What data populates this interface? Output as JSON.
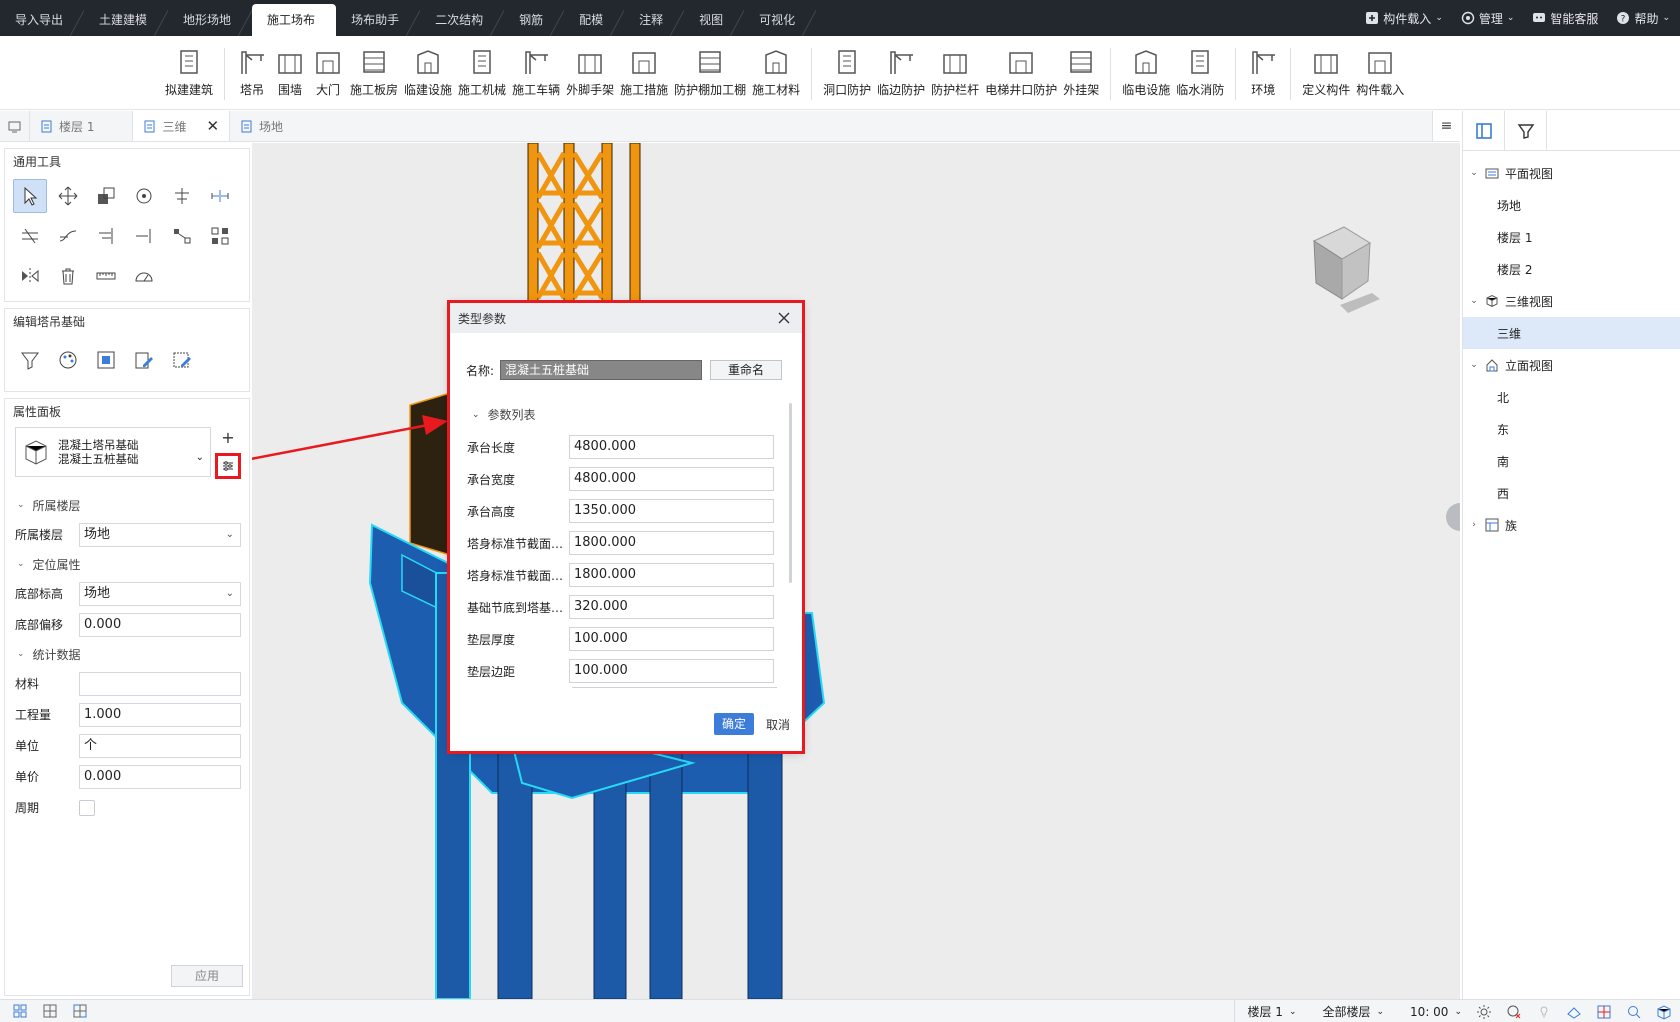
{
  "menu": {
    "tabs": [
      "导入导出",
      "土建建模",
      "地形场地",
      "施工场布",
      "场布助手",
      "二次结构",
      "钢筋",
      "配模",
      "注释",
      "视图",
      "可视化"
    ],
    "active_index": 3,
    "right": {
      "load": "构件载入",
      "manage": "管理",
      "service": "智能客服",
      "help": "帮助"
    }
  },
  "ribbon": {
    "groups": [
      [
        "拟建建筑"
      ],
      [
        "塔吊",
        "围墙",
        "大门",
        "施工板房",
        "临建设施",
        "施工机械",
        "施工车辆",
        "外脚手架",
        "施工措施",
        "防护棚加工棚",
        "施工材料"
      ],
      [
        "洞口防护",
        "临边防护",
        "防护栏杆",
        "电梯井口防护",
        "外挂架"
      ],
      [
        "临电设施",
        "临水消防"
      ],
      [
        "环境"
      ],
      [
        "定义构件",
        "构件载入"
      ]
    ]
  },
  "viewtabs": {
    "tabs": [
      "楼层 1",
      "三维",
      "场地"
    ],
    "active_index": 1
  },
  "leftpanel": {
    "tools_title": "通用工具",
    "edit_title": "编辑塔吊基础",
    "props_title": "属性面板",
    "type_line1": "混凝土塔吊基础",
    "type_line2": "混凝土五桩基础",
    "sections": {
      "floor": "所属楼层",
      "position": "定位属性",
      "stats": "统计数据"
    },
    "props": {
      "floor_label": "所属楼层",
      "floor_value": "场地",
      "base_label": "底部标高",
      "base_value": "场地",
      "offset_label": "底部偏移",
      "offset_value": "0.000",
      "material_label": "材料",
      "material_value": "",
      "qty_label": "工程量",
      "qty_value": "1.000",
      "unit_label": "单位",
      "unit_value": "个",
      "price_label": "单价",
      "price_value": "0.000",
      "period_label": "周期"
    },
    "apply": "应用"
  },
  "dialog": {
    "title": "类型参数",
    "name_label": "名称:",
    "name_value": "混凝土五桩基础",
    "rename": "重命名",
    "section": "参数列表",
    "params": [
      {
        "label": "承台长度",
        "value": "4800.000"
      },
      {
        "label": "承台宽度",
        "value": "4800.000"
      },
      {
        "label": "承台高度",
        "value": "1350.000"
      },
      {
        "label": "塔身标准节截面…",
        "value": "1800.000"
      },
      {
        "label": "塔身标准节截面…",
        "value": "1800.000"
      },
      {
        "label": "基础节底到塔基…",
        "value": "320.000"
      },
      {
        "label": "垫层厚度",
        "value": "100.000"
      },
      {
        "label": "垫层边距",
        "value": "100.000"
      }
    ],
    "ok": "确定",
    "cancel": "取消"
  },
  "tree": {
    "plan": "平面视图",
    "plan_items": [
      "场地",
      "楼层 1",
      "楼层 2"
    ],
    "threed": "三维视图",
    "threed_items": [
      "三维"
    ],
    "elev": "立面视图",
    "elev_items": [
      "北",
      "东",
      "南",
      "西"
    ],
    "family": "族"
  },
  "status": {
    "floor": "楼层 1",
    "all": "全部楼层",
    "time": "10: 00"
  },
  "colors": {
    "accent": "#3b7dd8",
    "highlight": "#e8191f",
    "crane": "#f0950f",
    "pile": "#1c5aa8",
    "outline": "#27d9f5"
  }
}
